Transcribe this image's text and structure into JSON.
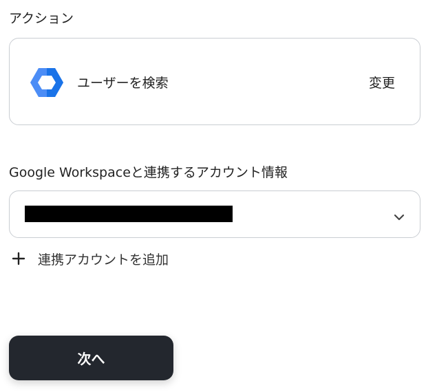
{
  "action_section": {
    "label": "アクション",
    "action_name": "ユーザーを検索",
    "change_label": "変更",
    "app_icon": "google-workspace-icon",
    "icon_colors": {
      "dark": "#1a73e8",
      "light": "#4c8df6",
      "center": "#ffffff"
    }
  },
  "account_section": {
    "label": "Google Workspaceと連携するアカウント情報",
    "selected_value": "",
    "selected_value_redacted": true,
    "dropdown_icon": "chevron-down-icon",
    "add_account_label": "連携アカウントを追加",
    "add_icon": "plus-icon"
  },
  "footer": {
    "next_label": "次へ",
    "next_bg": "#23272e"
  }
}
